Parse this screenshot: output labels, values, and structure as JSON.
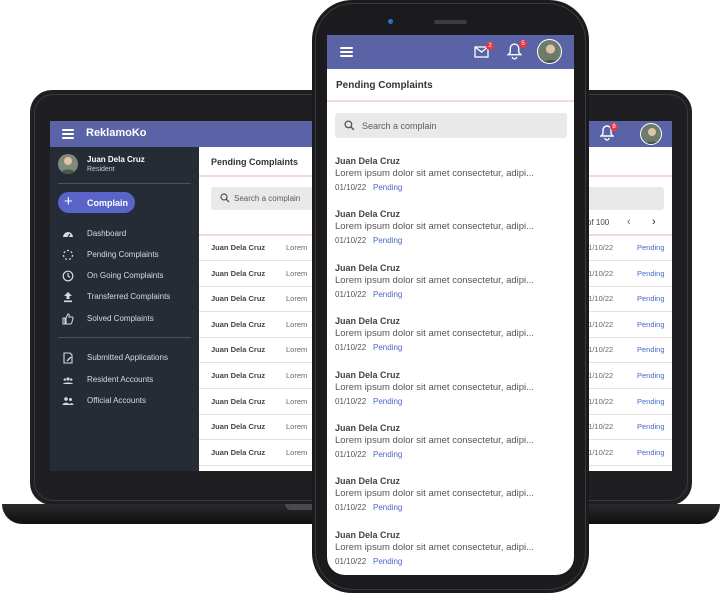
{
  "desktop": {
    "brand": "ReklamoKo",
    "user": {
      "name": "Juan Dela Cruz",
      "role": "Resident"
    },
    "complain_button": "Complain",
    "nav_primary": [
      {
        "label": "Dashboard",
        "icon": "dashboard-icon"
      },
      {
        "label": "Pending Complaints",
        "icon": "pending-icon"
      },
      {
        "label": "On Going Complaints",
        "icon": "clock-icon"
      },
      {
        "label": "Transferred Complaints",
        "icon": "upload-icon"
      },
      {
        "label": "Solved Complaints",
        "icon": "thumbs-up-icon"
      }
    ],
    "nav_secondary": [
      {
        "label": "Submitted Applications",
        "icon": "edit-document-icon"
      },
      {
        "label": "Resident Accounts",
        "icon": "group-icon"
      },
      {
        "label": "Official Accounts",
        "icon": "people-icon"
      }
    ],
    "page_title": "Pending Complaints",
    "search_placeholder": "Search a complain",
    "pager": {
      "text": "of 100",
      "prev": "‹",
      "next": "›"
    },
    "rows": [
      {
        "name": "Juan Dela Cruz",
        "desc": "Lorem",
        "date": "01/10/22",
        "status": "Pending"
      },
      {
        "name": "Juan Dela Cruz",
        "desc": "Lorem",
        "date": "01/10/22",
        "status": "Pending"
      },
      {
        "name": "Juan Dela Cruz",
        "desc": "Lorem",
        "date": "01/10/22",
        "status": "Pending"
      },
      {
        "name": "Juan Dela Cruz",
        "desc": "Lorem",
        "date": "01/10/22",
        "status": "Pending"
      },
      {
        "name": "Juan Dela Cruz",
        "desc": "Lorem",
        "date": "01/10/22",
        "status": "Pending"
      },
      {
        "name": "Juan Dela Cruz",
        "desc": "Lorem",
        "date": "01/10/22",
        "status": "Pending"
      },
      {
        "name": "Juan Dela Cruz",
        "desc": "Lorem",
        "date": "01/10/22",
        "status": "Pending"
      },
      {
        "name": "Juan Dela Cruz",
        "desc": "Lorem",
        "date": "01/10/22",
        "status": "Pending"
      },
      {
        "name": "Juan Dela Cruz",
        "desc": "Lorem",
        "date": "01/10/22",
        "status": "Pending"
      }
    ],
    "notifications": "8"
  },
  "mobile": {
    "mail_badge": "2",
    "bell_badge": "5",
    "page_title": "Pending Complaints",
    "search_placeholder": "Search a complain",
    "items": [
      {
        "name": "Juan Dela Cruz",
        "desc": "Lorem ipsum dolor sit amet consectetur, adipi...",
        "date": "01/10/22",
        "status": "Pending"
      },
      {
        "name": "Juan Dela Cruz",
        "desc": "Lorem ipsum dolor sit amet consectetur, adipi...",
        "date": "01/10/22",
        "status": "Pending"
      },
      {
        "name": "Juan Dela Cruz",
        "desc": "Lorem ipsum dolor sit amet consectetur, adipi...",
        "date": "01/10/22",
        "status": "Pending"
      },
      {
        "name": "Juan Dela Cruz",
        "desc": "Lorem ipsum dolor sit amet consectetur, adipi...",
        "date": "01/10/22",
        "status": "Pending"
      },
      {
        "name": "Juan Dela Cruz",
        "desc": "Lorem ipsum dolor sit amet consectetur, adipi...",
        "date": "01/10/22",
        "status": "Pending"
      },
      {
        "name": "Juan Dela Cruz",
        "desc": "Lorem ipsum dolor sit amet consectetur, adipi...",
        "date": "01/10/22",
        "status": "Pending"
      },
      {
        "name": "Juan Dela Cruz",
        "desc": "Lorem ipsum dolor sit amet consectetur, adipi...",
        "date": "01/10/22",
        "status": "Pending"
      },
      {
        "name": "Juan Dela Cruz",
        "desc": "Lorem ipsum dolor sit amet consectetur, adipi...",
        "date": "01/10/22",
        "status": "Pending"
      }
    ]
  },
  "colors": {
    "primary": "#5a63a6",
    "sidebar": "#262c36",
    "accent_button": "#5a63c8",
    "status": "#4a67c8",
    "badge": "#e53945",
    "divider": "#f6d7dc"
  }
}
